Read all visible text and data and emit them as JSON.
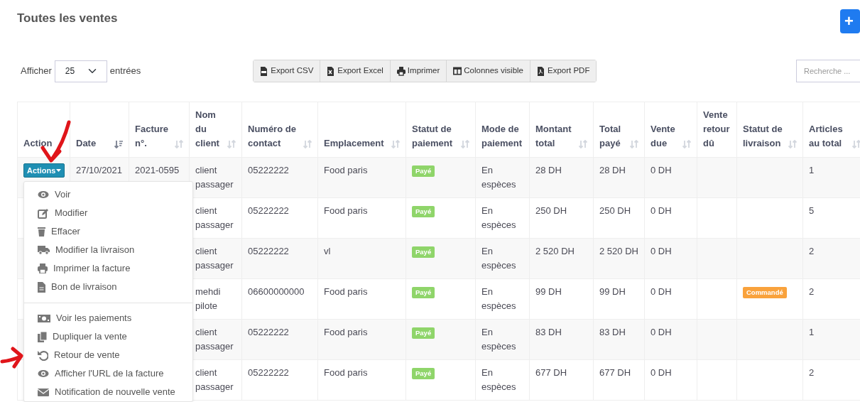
{
  "page_title": "Toutes les ventes",
  "add_button": "+",
  "length_control": {
    "prefix": "Afficher",
    "value": "25",
    "suffix": "entrées"
  },
  "export_buttons": [
    "Export CSV",
    "Export Excel",
    "Imprimer",
    "Colonnes visible",
    "Export PDF"
  ],
  "search": {
    "placeholder": "Recherche ..."
  },
  "table": {
    "columns": [
      {
        "label": "Action",
        "sortable": false,
        "sorted": false
      },
      {
        "label": "Date",
        "sortable": true,
        "sorted": true
      },
      {
        "label": "Facture n°.",
        "sortable": true,
        "sorted": false
      },
      {
        "label": "Nom du client",
        "sortable": true,
        "sorted": false
      },
      {
        "label": "Numéro de contact",
        "sortable": true,
        "sorted": false
      },
      {
        "label": "Emplacement",
        "sortable": true,
        "sorted": false
      },
      {
        "label": "Statut de paiement",
        "sortable": true,
        "sorted": false
      },
      {
        "label": "Mode de paiement",
        "sortable": false,
        "sorted": false
      },
      {
        "label": "Montant total",
        "sortable": true,
        "sorted": false
      },
      {
        "label": "Total payé",
        "sortable": true,
        "sorted": false
      },
      {
        "label": "Vente due",
        "sortable": true,
        "sorted": false
      },
      {
        "label": "Vente retour dû",
        "sortable": false,
        "sorted": false
      },
      {
        "label": "Statut de livraison",
        "sortable": true,
        "sorted": false
      },
      {
        "label": "Articles au total",
        "sortable": true,
        "sorted": false
      }
    ],
    "rows": [
      {
        "action": "Actions",
        "date": "27/10/2021",
        "invoice": "2021-0595",
        "customer": "client passager",
        "contact": "05222222",
        "location": "Food paris",
        "payment_status": "Payé",
        "payment_method": "En espèces",
        "total_amount": "28 DH",
        "total_paid": "28 DH",
        "sale_due": "0 DH",
        "total_items": "1"
      },
      {
        "customer": "client passager",
        "contact": "05222222",
        "location": "Food paris",
        "payment_status": "Payé",
        "payment_method": "En espèces",
        "total_amount": "250 DH",
        "total_paid": "250 DH",
        "sale_due": "0 DH",
        "total_items": "5"
      },
      {
        "customer": "client passager",
        "contact": "05222222",
        "location": "vl",
        "payment_status": "Payé",
        "payment_method": "En espèces",
        "total_amount": "2 520 DH",
        "total_paid": "2 520 DH",
        "sale_due": "0 DH",
        "total_items": "2"
      },
      {
        "customer": "mehdi pilote",
        "contact": "06600000000",
        "location": "Food paris",
        "payment_status": "Payé",
        "payment_method": "En espèces",
        "total_amount": "99 DH",
        "total_paid": "99 DH",
        "sale_due": "0 DH",
        "delivery_status": "Commandé",
        "total_items": "2"
      },
      {
        "customer": "client passager",
        "contact": "05222222",
        "location": "Food paris",
        "payment_status": "Payé",
        "payment_method": "En espèces",
        "total_amount": "83 DH",
        "total_paid": "83 DH",
        "sale_due": "0 DH",
        "total_items": "1"
      },
      {
        "customer": "client passager",
        "contact": "05222222",
        "location": "Food paris",
        "payment_status": "Payé",
        "payment_method": "En espèces",
        "total_amount": "677 DH",
        "total_paid": "677 DH",
        "sale_due": "0 DH",
        "total_items": "2"
      }
    ]
  },
  "actions_menu": {
    "groups": [
      [
        "Voir",
        "Modifier",
        "Effacer",
        "Modifier la livraison",
        "Imprimer la facture",
        "Bon de livraison"
      ],
      [
        "Voir les paiements",
        "Dupliquer la vente",
        "Retour de vente",
        "Afficher l'URL de la facture",
        "Notification de nouvelle vente"
      ]
    ]
  }
}
